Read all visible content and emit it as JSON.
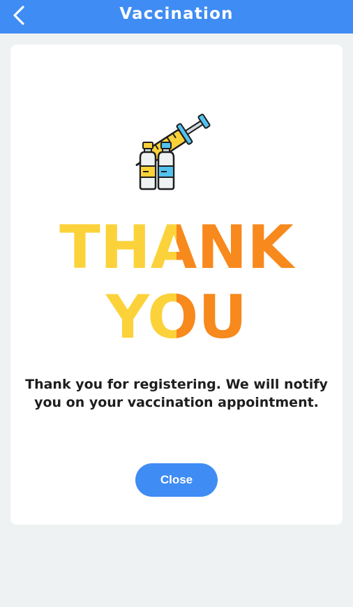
{
  "header": {
    "title": "Vaccination",
    "back_icon": "chevron-left-icon",
    "background_color": "#3f8cf4"
  },
  "illustration": {
    "icon": "vaccine-syringe-vials-icon"
  },
  "thank_you": {
    "line1": "THANK",
    "line2": "YOU",
    "colors": {
      "yellow": "#fcd23a",
      "orange": "#f7891d"
    }
  },
  "message": "Thank you for registering. We will notify you on your vaccination appointment.",
  "close_button": {
    "label": "Close",
    "color": "#3f8cf4"
  }
}
